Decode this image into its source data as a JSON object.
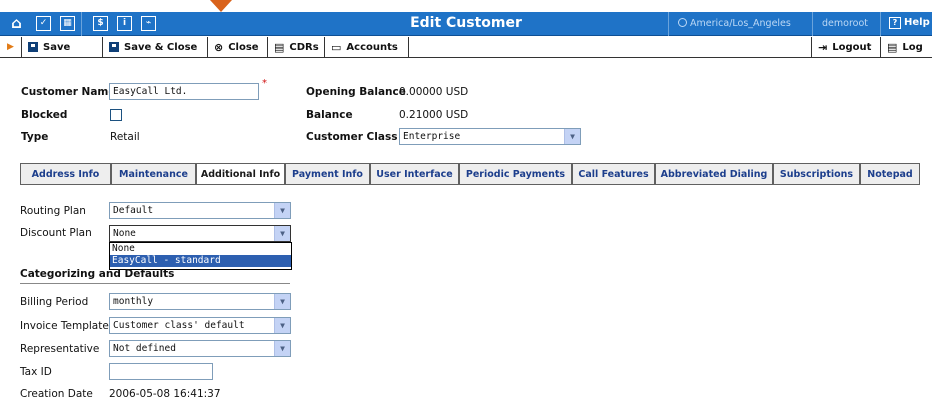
{
  "header": {
    "title": "Edit Customer",
    "timezone": "America/Los_Angeles",
    "user": "demoroot",
    "help_label": "Help",
    "icons": [
      "home-icon",
      "check-icon",
      "grid-icon",
      "dollar-icon",
      "info-icon",
      "chart-icon"
    ]
  },
  "toolbar": {
    "save_label": "Save",
    "save_close_label": "Save & Close",
    "close_label": "Close",
    "cdrs_label": "CDRs",
    "accounts_label": "Accounts",
    "logout_label": "Logout",
    "log_label": "Log"
  },
  "form": {
    "customer_name_label": "Customer Name",
    "customer_name_value": "EasyCall Ltd.",
    "required_mark": "*",
    "blocked_label": "Blocked",
    "type_label": "Type",
    "type_value": "Retail",
    "opening_balance_label": "Opening Balance",
    "opening_balance_value": "0.00000 USD",
    "balance_label": "Balance",
    "balance_value": "0.21000 USD",
    "customer_class_label": "Customer Class",
    "customer_class_value": "Enterprise"
  },
  "tabs": [
    {
      "label": "Address Info"
    },
    {
      "label": "Maintenance"
    },
    {
      "label": "Additional Info"
    },
    {
      "label": "Payment Info"
    },
    {
      "label": "User Interface"
    },
    {
      "label": "Periodic Payments"
    },
    {
      "label": "Call Features"
    },
    {
      "label": "Abbreviated Dialing"
    },
    {
      "label": "Subscriptions"
    },
    {
      "label": "Notepad"
    }
  ],
  "additional": {
    "routing_plan_label": "Routing Plan",
    "routing_plan_value": "Default",
    "discount_plan_label": "Discount Plan",
    "discount_plan_value": "None",
    "discount_options": [
      "None",
      "EasyCall - standard"
    ],
    "section_title": "Categorizing and Defaults",
    "billing_period_label": "Billing Period",
    "billing_period_value": "monthly",
    "invoice_template_label": "Invoice Template",
    "invoice_template_value": "Customer class' default",
    "representative_label": "Representative",
    "representative_value": "Not defined",
    "tax_id_label": "Tax ID",
    "tax_id_value": "",
    "creation_date_label": "Creation Date",
    "creation_date_value": "2006-05-08 16:41:37"
  },
  "colors": {
    "header_bg": "#1f73c7",
    "active_tab_bg": "#ffffff",
    "tab_text": "#1c3e8c",
    "dropdown_selected": "#2d5fb0",
    "marker": "#d9621b"
  }
}
